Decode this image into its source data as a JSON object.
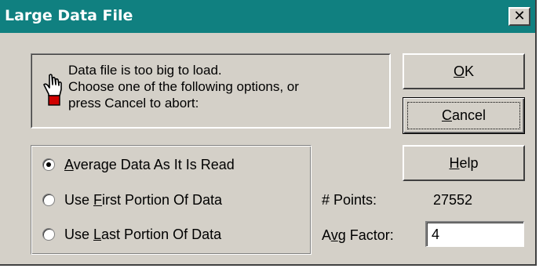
{
  "window": {
    "title": "Large Data File",
    "close_glyph": "✕"
  },
  "message": {
    "icon": "hand-icon",
    "lines": [
      "Data file is too big to load.",
      "Choose one of the following options, or",
      "press Cancel to abort:"
    ]
  },
  "buttons": {
    "ok": {
      "mnemonic": "O",
      "rest": "K"
    },
    "cancel": {
      "mnemonic": "C",
      "rest": "ancel"
    },
    "help": {
      "mnemonic": "H",
      "rest": "elp"
    }
  },
  "options": [
    {
      "mnemonic": "A",
      "rest": "verage Data As It Is Read",
      "checked": true
    },
    {
      "pre": "Use ",
      "mnemonic": "F",
      "rest": "irst Portion Of Data",
      "checked": false
    },
    {
      "pre": "Use ",
      "mnemonic": "L",
      "rest": "ast Portion Of Data",
      "checked": false
    }
  ],
  "points": {
    "label": "# Points:",
    "value": "27552"
  },
  "avg_factor": {
    "label_pre": "A",
    "mnemonic": "v",
    "label_post": "g Factor:",
    "value": "4"
  }
}
